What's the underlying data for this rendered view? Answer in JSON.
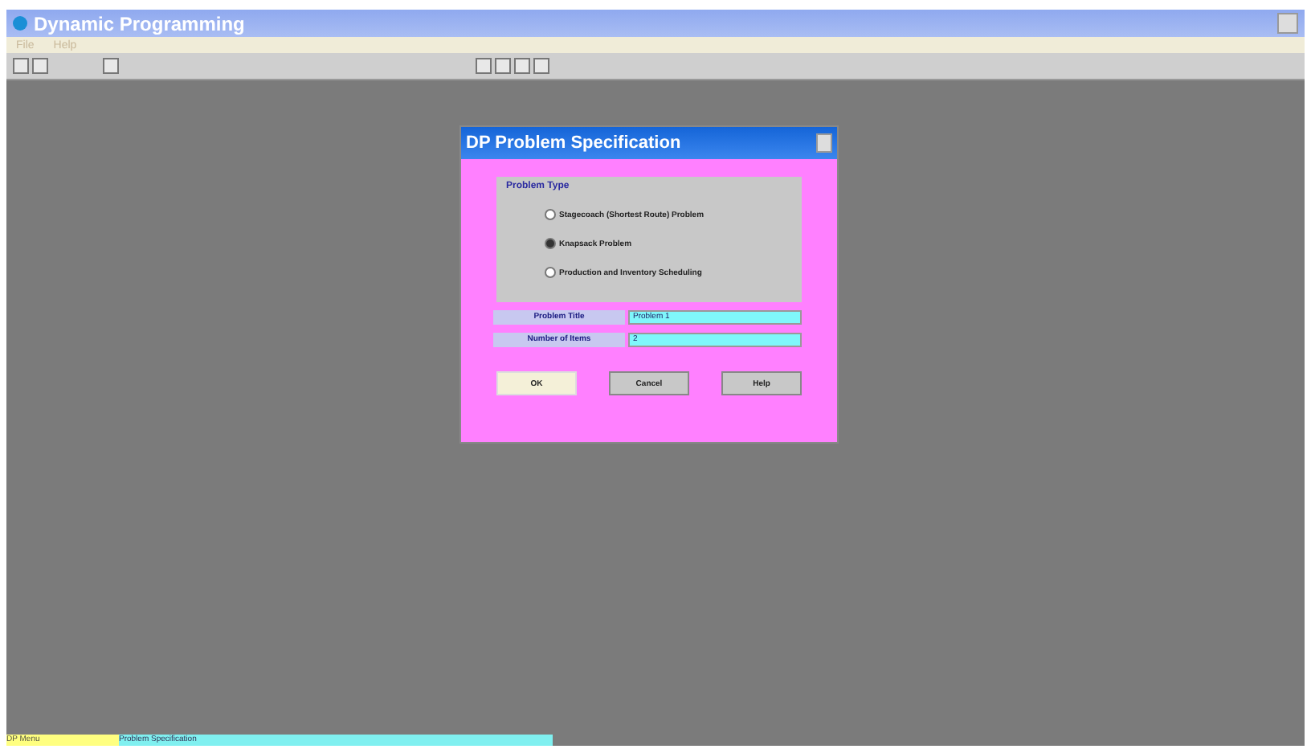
{
  "window": {
    "title": "Dynamic Programming"
  },
  "menu": [
    "File",
    "Help"
  ],
  "dialog": {
    "title": "DP Problem Specification",
    "group_title": "Problem Type",
    "options": [
      {
        "label": "Stagecoach (Shortest Route) Problem",
        "selected": false
      },
      {
        "label": "Knapsack Problem",
        "selected": true
      },
      {
        "label": "Production and Inventory Scheduling",
        "selected": false
      }
    ],
    "fields": [
      {
        "label": "Problem Title",
        "value": "Problem 1"
      },
      {
        "label": "Number of Items",
        "value": "2"
      }
    ],
    "buttons": [
      {
        "label": "OK",
        "kind": "default"
      },
      {
        "label": "Cancel",
        "kind": "normal"
      },
      {
        "label": "Help",
        "kind": "normal"
      }
    ]
  },
  "status_bar": [
    "DP Menu",
    "Problem Specification"
  ]
}
